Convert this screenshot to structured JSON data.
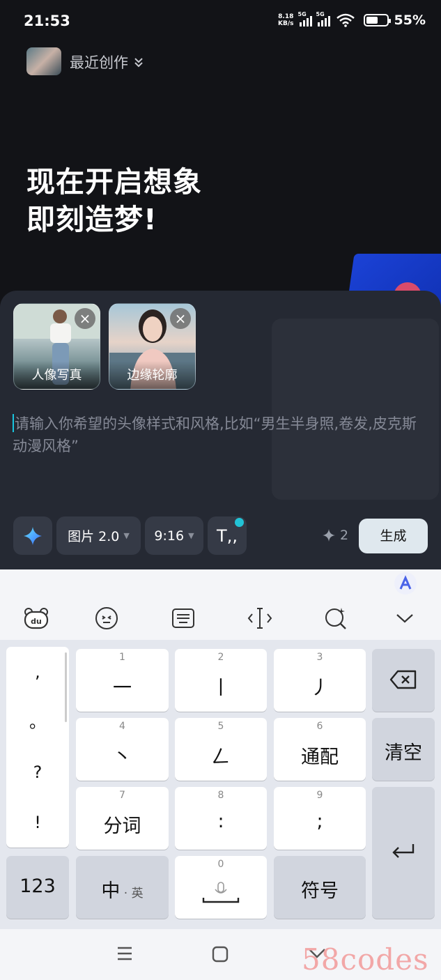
{
  "status_bar": {
    "time": "21:53",
    "net_speed_top": "8.18",
    "net_speed_unit": "KB/s",
    "sig_tag": "5G",
    "wifi_tag": "6",
    "battery": "55%"
  },
  "header": {
    "recent_label": "最近创作"
  },
  "hero": {
    "line1": "现在开启想象",
    "line2": "即刻造梦!"
  },
  "chips": [
    {
      "label": "人像写真"
    },
    {
      "label": "边缘轮廓"
    }
  ],
  "prompt": {
    "placeholder": "请输入你希望的头像样式和风格,比如“男生半身照,卷发,皮克斯动漫风格”"
  },
  "toolbar": {
    "model": "图片 2.0",
    "ratio": "9:16",
    "text_style": "T,,",
    "credits": "2",
    "generate": "生成"
  },
  "keyboard": {
    "top_icons": [
      "bear-du-icon",
      "emoji-icon",
      "keyboard-icon",
      "text-cursor-icon",
      "magic-search-icon",
      "collapse-icon"
    ],
    "punct": [
      ",",
      "。",
      "?",
      "!"
    ],
    "keys": [
      {
        "n": "1",
        "m": "一"
      },
      {
        "n": "2",
        "m": "丨"
      },
      {
        "n": "3",
        "m": "丿"
      },
      {
        "n": "4",
        "m": "丶"
      },
      {
        "n": "5",
        "m": "𠃋"
      },
      {
        "n": "6",
        "m": "通配"
      },
      {
        "n": "7",
        "m": "分词"
      },
      {
        "n": "8",
        "m": ":"
      },
      {
        "n": "9",
        "m": ";"
      }
    ],
    "clear": "清空",
    "num": "123",
    "lang_main": "中",
    "lang_sub": "英",
    "zero": "0",
    "symbol": "符号"
  },
  "watermark": "58codes"
}
